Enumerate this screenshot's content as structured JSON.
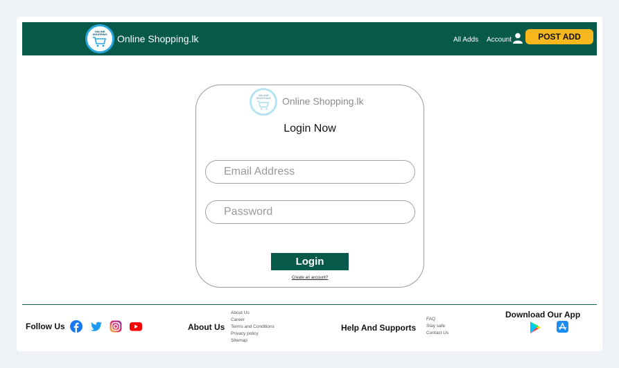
{
  "header": {
    "logo_text": "ONLINE SHOPPING",
    "brand": "Online Shopping.lk",
    "nav": {
      "all_adds": "All Adds",
      "account": "Account"
    },
    "post_add": "POST ADD"
  },
  "login": {
    "logo_text": "ONLINE SHOPPING",
    "brand": "Online Shopping.lk",
    "title": "Login Now",
    "email_placeholder": "Email Address",
    "password_placeholder": "Password",
    "submit": "Login",
    "create_account": "Create an account?"
  },
  "footer": {
    "follow_us": "Follow Us",
    "social_icons": [
      "facebook-icon",
      "twitter-icon",
      "instagram-icon",
      "youtube-icon"
    ],
    "about": {
      "heading": "About Us",
      "links": [
        "About Us",
        "Career",
        "Terms and Conditions",
        "Privacy policy",
        "Sitemap"
      ]
    },
    "help": {
      "heading": "Help And Supports",
      "links": [
        "FAQ",
        "Stay safe",
        "Contact Us"
      ]
    },
    "download": {
      "heading": "Download Our App",
      "icons": [
        "google-play-icon",
        "app-store-icon"
      ]
    }
  },
  "colors": {
    "primary": "#075a4a",
    "accent": "#f6b81c",
    "logo_ring": "#2aa7df"
  }
}
